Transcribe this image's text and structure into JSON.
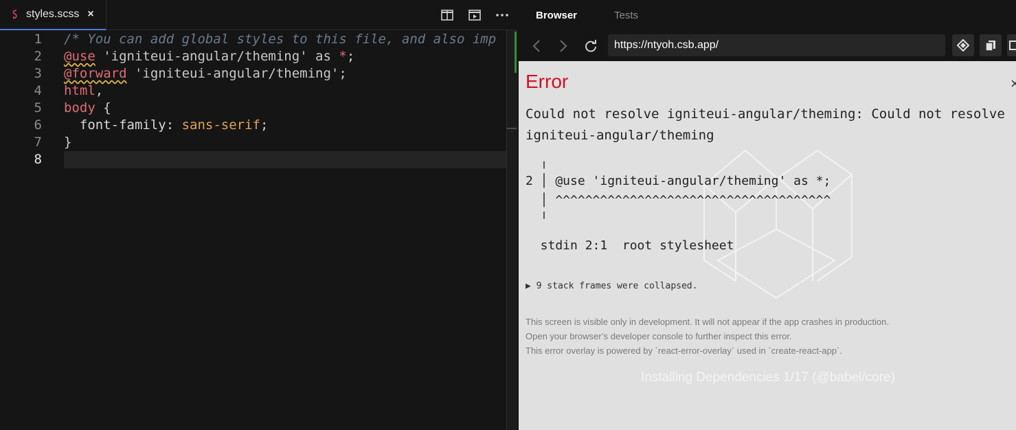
{
  "editor": {
    "tab": {
      "icon": "sass-icon",
      "filename": "styles.scss",
      "close": "×"
    },
    "actions": [
      "split-editor-icon",
      "preview-icon",
      "more-icon"
    ],
    "lines": [
      {
        "n": "1",
        "text": "/* You can add global styles to this file, and also imp"
      },
      {
        "n": "2",
        "at": "@use",
        "rest": " 'igniteui-angular/theming' as ",
        "star": "*",
        "end": ";"
      },
      {
        "n": "3",
        "at": "@forward",
        "rest": " 'igniteui-angular/theming';"
      },
      {
        "n": "4",
        "sel": "html",
        "rest": ","
      },
      {
        "n": "5",
        "sel": "body",
        "rest": " {"
      },
      {
        "n": "6",
        "prop": "  font-family: ",
        "val": "sans-serif",
        "end": ";"
      },
      {
        "n": "7",
        "text": "}"
      },
      {
        "n": "8",
        "text": ""
      }
    ]
  },
  "browser": {
    "tabs": {
      "browser": "Browser",
      "tests": "Tests"
    },
    "url": "https://ntyoh.csb.app/",
    "error": {
      "title": "Error",
      "close": "×",
      "message": "Could not resolve igniteui-angular/theming: Could not resolve igniteui-angular/theming",
      "code_lines": [
        "  ╷",
        "2 │ @use 'igniteui-angular/theming' as *;",
        "  │ ^^^^^^^^^^^^^^^^^^^^^^^^^^^^^^^^^^^^^",
        "  ╵",
        "",
        "  stdin 2:1  root stylesheet"
      ],
      "frames": "▶ 9 stack frames were collapsed.",
      "footer": [
        "This screen is visible only in development. It will not appear if the app crashes in production.",
        "Open your browser’s developer console to further inspect this error.",
        "This error overlay is powered by `react-error-overlay` used in `create-react-app`."
      ]
    },
    "installing": "Installing Dependencies 1/17 (@babel/core)"
  }
}
